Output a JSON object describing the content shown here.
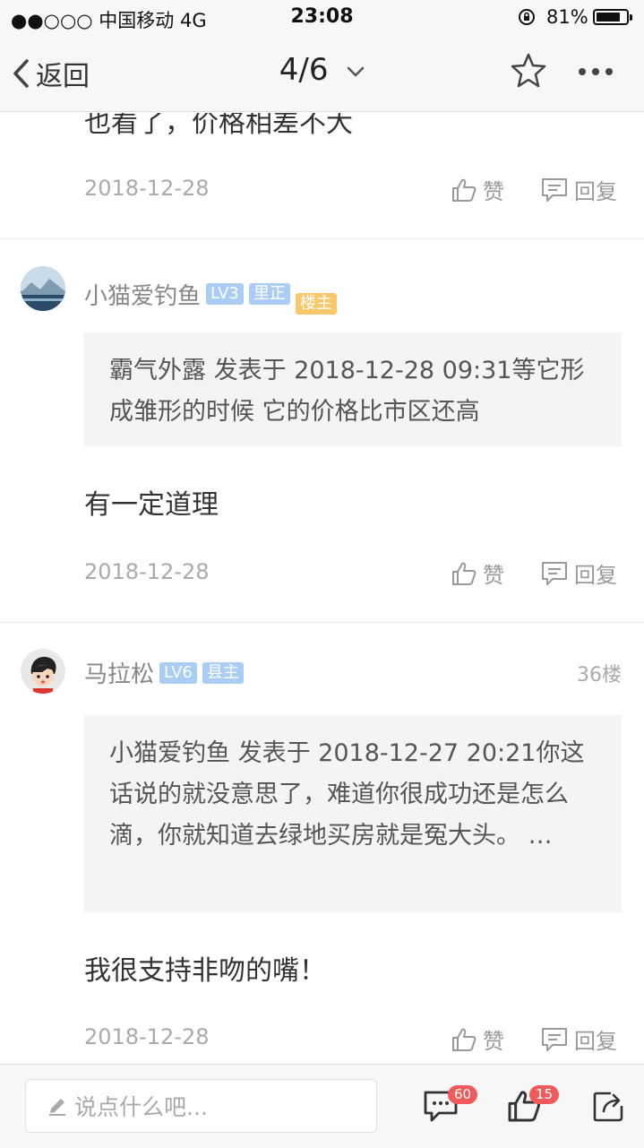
{
  "status_bar": {
    "carrier": "●●○○○ 中国移动  4G",
    "time": "23:08",
    "battery": "81%",
    "battery_level": 0.81
  },
  "nav": {
    "back_label": "返回",
    "page_indicator": "4/6"
  },
  "posts": [
    {
      "text_partial": "也看了，价格相差不大",
      "date": "2018-12-28",
      "like_label": "赞",
      "reply_label": "回复"
    },
    {
      "username": "小猫爱钓鱼",
      "badges": [
        "LV3",
        "里正",
        "楼主"
      ],
      "quote": "霸气外露 发表于 2018-12-28 09:31等它形成雏形的时候 它的价格比市区还高",
      "text": "有一定道理",
      "date": "2018-12-28",
      "like_label": "赞",
      "reply_label": "回复"
    },
    {
      "username": "马拉松",
      "badges": [
        "LV6",
        "县主"
      ],
      "floor": "36楼",
      "quote": "小猫爱钓鱼 发表于 2018-12-27 20:21你这话说的就没意思了，难道你很成功还是怎么滴，你就知道去绿地买房就是冤大头。 …",
      "text": "我很支持非吻的嘴！",
      "date": "2018-12-28",
      "like_label": "赞",
      "reply_label": "回复"
    }
  ],
  "bottom_bar": {
    "input_placeholder": "说点什么吧...",
    "comment_count": "60",
    "like_count": "15"
  },
  "colors": {
    "badge_blue": "#a9cdf5",
    "badge_gold": "#f9c76b",
    "count_red": "#f05a5a"
  }
}
